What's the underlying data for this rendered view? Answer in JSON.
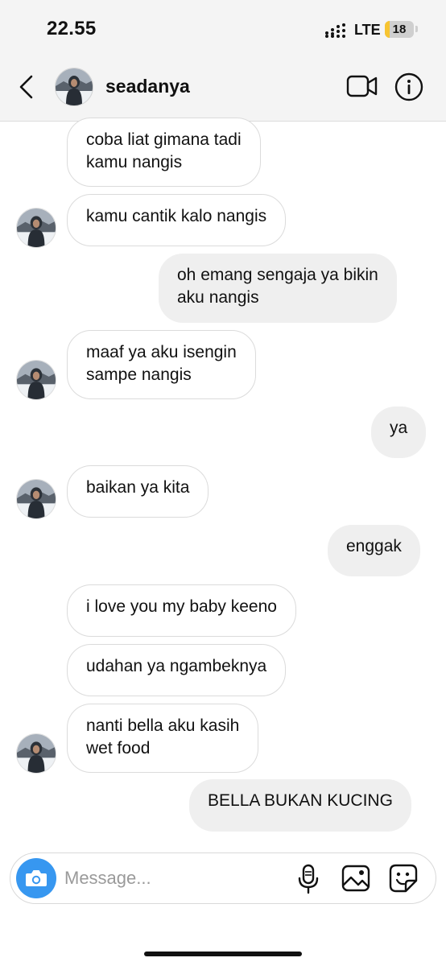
{
  "status_bar": {
    "time": "22.55",
    "network": "LTE",
    "battery_level": "18",
    "battery_fraction": 0.18,
    "battery_color": "#f7c431"
  },
  "header": {
    "username": "seadanya",
    "icons": {
      "back": "chevron-left-icon",
      "video": "video-call-icon",
      "info": "info-icon"
    }
  },
  "messages": [
    {
      "side": "in",
      "lines": [
        "coba liat gimana tadi",
        "kamu nangis"
      ]
    },
    {
      "side": "in",
      "lines": [
        "kamu cantik kalo nangis"
      ]
    },
    {
      "side": "out",
      "lines": [
        "oh emang sengaja ya bikin",
        "aku nangis"
      ]
    },
    {
      "side": "in",
      "lines": [
        "maaf ya aku isengin",
        "sampe nangis"
      ]
    },
    {
      "side": "out",
      "lines": [
        "ya"
      ]
    },
    {
      "side": "in",
      "lines": [
        "baikan ya kita"
      ]
    },
    {
      "side": "out",
      "lines": [
        "enggak"
      ]
    },
    {
      "side": "in",
      "lines": [
        "i love you my baby keeno"
      ]
    },
    {
      "side": "in",
      "lines": [
        "udahan ya ngambeknya"
      ]
    },
    {
      "side": "in",
      "lines": [
        "nanti bella aku kasih",
        "wet food"
      ]
    },
    {
      "side": "out",
      "lines": [
        "BELLA BUKAN KUCING"
      ]
    }
  ],
  "composer": {
    "placeholder": "Message...",
    "value": "",
    "icons": {
      "camera": "camera-icon",
      "mic": "microphone-icon",
      "gallery": "gallery-icon",
      "sticker": "sticker-icon"
    },
    "accent_color": "#3797f0"
  },
  "colors": {
    "incoming_border": "#dbdbdb",
    "outgoing_bg": "#efefef",
    "header_bg": "#f4f4f4"
  }
}
